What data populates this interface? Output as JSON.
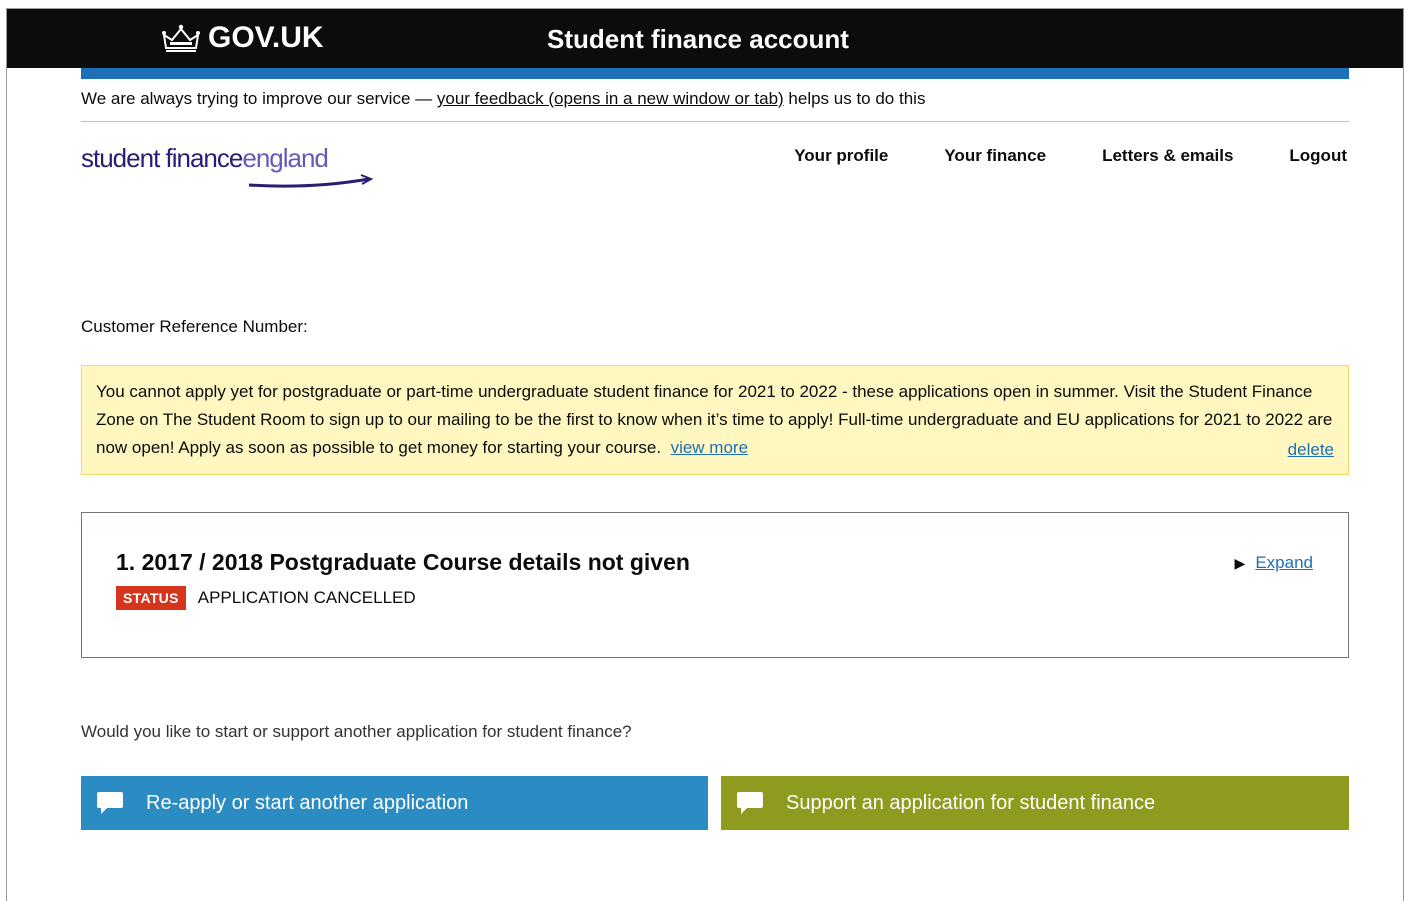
{
  "header": {
    "gov_logo_text": "GOV.UK",
    "service_name": "Student finance account"
  },
  "beta_banner": {
    "prefix": "We are always trying to improve our service — ",
    "link": "your feedback (opens in a new window or tab)",
    "suffix": " helps us to do this"
  },
  "logo": {
    "part1": "student finance",
    "part2": "england"
  },
  "nav": {
    "items": [
      "Your profile",
      "Your finance",
      "Letters & emails",
      "Logout"
    ]
  },
  "customer": {
    "label": "Customer Reference Number:"
  },
  "notice": {
    "text": "You cannot apply yet for postgraduate or part-time undergraduate student finance for 2021 to 2022 - these applications open in summer. Visit the Student Finance Zone on The Student Room to sign up to our mailing to be the first to know when it’s time to apply! Full-time undergraduate and EU applications for 2021 to 2022 are now open! Apply as soon as possible to get money for starting your course.",
    "view_more": "view more",
    "delete": "delete",
    "background_color": "#fff7bf"
  },
  "application": {
    "title": "1. 2017 / 2018 Postgraduate Course details not given",
    "expand_label": "Expand",
    "status_badge": "STATUS",
    "status_text": "APPLICATION CANCELLED",
    "status_color": "#d4351c"
  },
  "question": "Would you like to start or support another application for student finance?",
  "buttons": {
    "reapply": "Re-apply or start another application",
    "support": "Support an application for student finance",
    "reapply_color": "#2b8cc4",
    "support_color": "#8e9b1e"
  },
  "icons": {
    "gov": "crown-icon",
    "buttons": "chat-bubble-icon",
    "expand": "triangle-right-icon"
  }
}
